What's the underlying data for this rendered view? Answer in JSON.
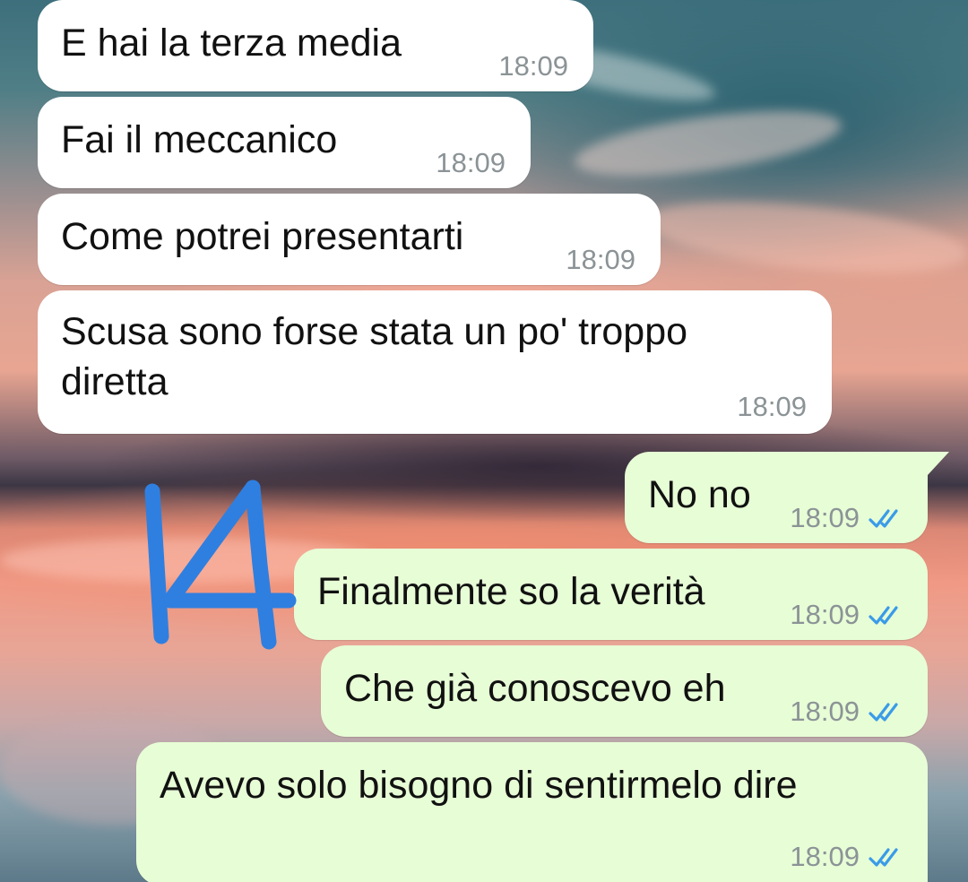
{
  "colors": {
    "incoming_bubble": "#ffffff",
    "outgoing_bubble": "#e7fdd6",
    "timestamp": "#8b9396",
    "read_ticks": "#3a9be8",
    "annotation_marker": "#2f7fe0"
  },
  "messages": [
    {
      "direction": "in",
      "text": "E hai la terza media",
      "time": "18:09"
    },
    {
      "direction": "in",
      "text": "Fai il meccanico",
      "time": "18:09"
    },
    {
      "direction": "in",
      "text": "Come potrei presentarti",
      "time": "18:09"
    },
    {
      "direction": "in",
      "text": "Scusa sono forse stata un po' troppo\ndiretta",
      "time": "18:09"
    },
    {
      "direction": "out",
      "text": "No no",
      "time": "18:09",
      "status_icon": "double-check-read-icon"
    },
    {
      "direction": "out",
      "text": "Finalmente so la verità",
      "time": "18:09",
      "status_icon": "double-check-read-icon"
    },
    {
      "direction": "out",
      "text": "Che già conoscevo eh",
      "time": "18:09",
      "status_icon": "double-check-read-icon"
    },
    {
      "direction": "out",
      "text": "Avevo solo bisogno di sentirmelo dire",
      "time": "18:09",
      "status_icon": "double-check-read-icon"
    }
  ],
  "annotation": {
    "icon": "handwritten-14-marker",
    "text": "14"
  }
}
